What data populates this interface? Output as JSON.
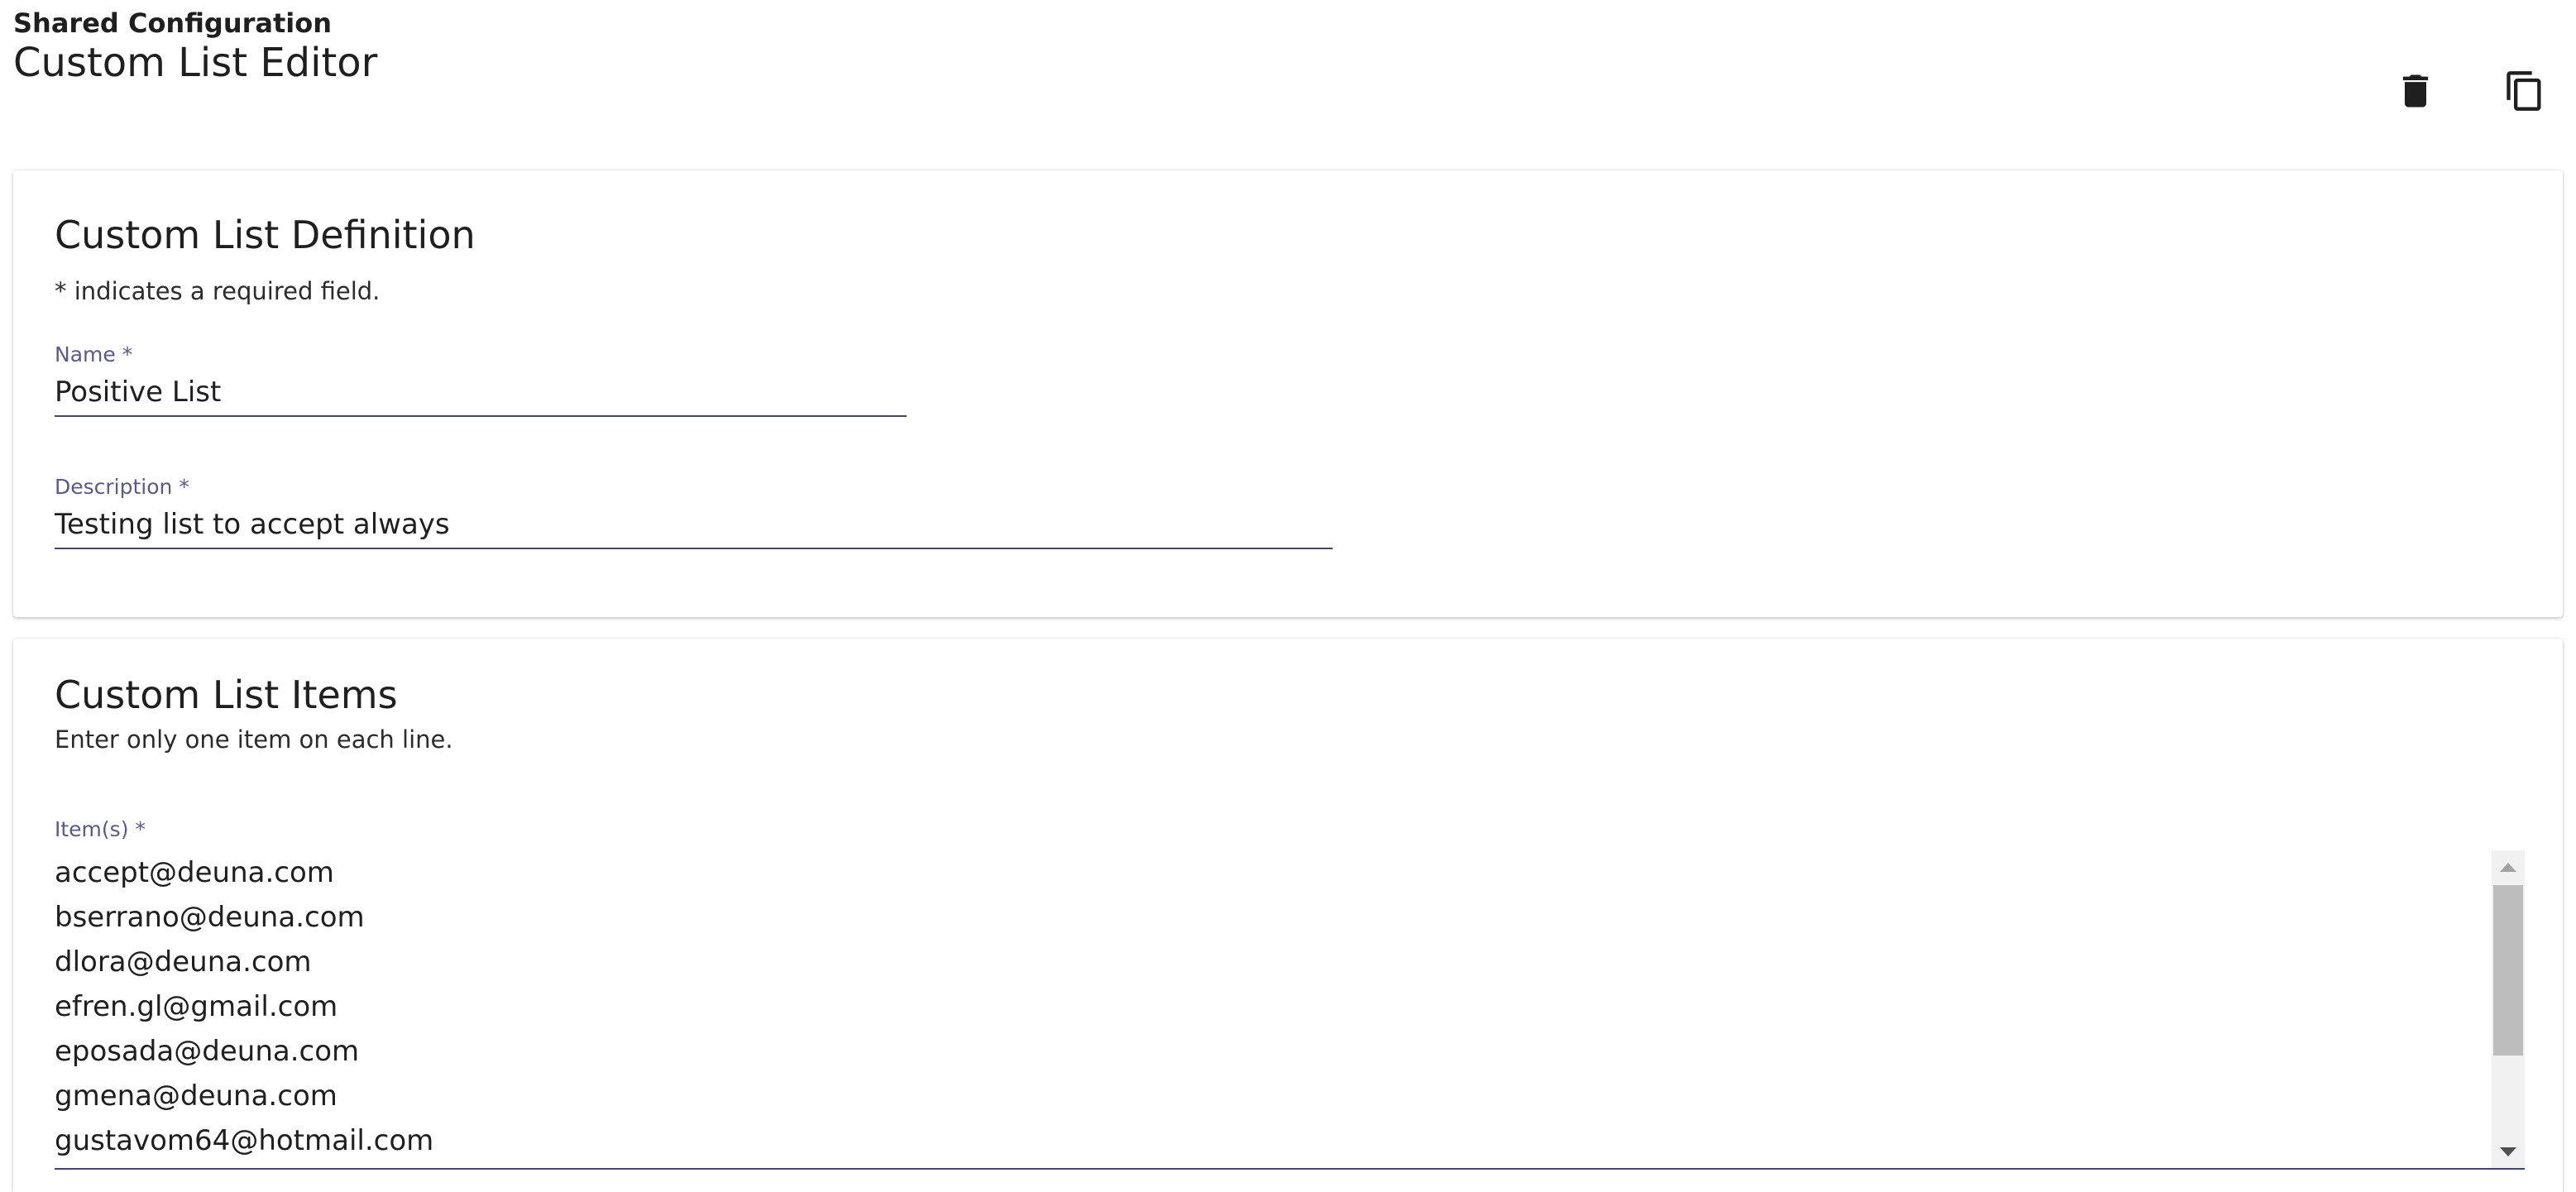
{
  "header": {
    "breadcrumb": "Shared Configuration",
    "title": "Custom List Editor",
    "actions": [
      {
        "name": "delete",
        "icon": "trash-icon"
      },
      {
        "name": "copy",
        "icon": "copy-icon"
      }
    ]
  },
  "definition": {
    "title": "Custom List Definition",
    "required_hint": "* indicates a required field.",
    "name": {
      "label": "Name *",
      "value": "Positive List"
    },
    "description": {
      "label": "Description *",
      "value": "Testing list to accept always"
    }
  },
  "items": {
    "title": "Custom List Items",
    "hint": "Enter only one item on each line.",
    "label": "Item(s) *",
    "values": [
      "accept@deuna.com",
      "bserrano@deuna.com",
      "dlora@deuna.com",
      "efren.gl@gmail.com",
      "eposada@deuna.com",
      "gmena@deuna.com",
      "gustavom64@hotmail.com"
    ]
  },
  "colors": {
    "label_text": "#5a5a8a",
    "underline": "#45456a",
    "text": "#1f1f1f"
  }
}
